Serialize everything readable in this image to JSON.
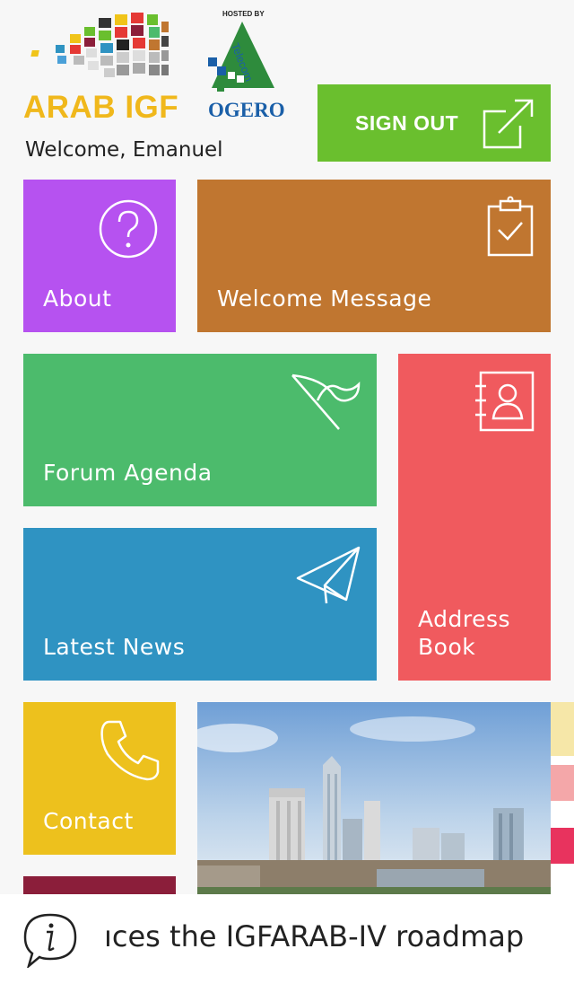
{
  "header": {
    "logo_text": "ARAB IGF",
    "hosted_by": "HOSTED BY",
    "host_logo_text": "OGERO",
    "host_logo_sub": "Telecom",
    "welcome_text": "Welcome, Emanuel",
    "signout_label": "SIGN OUT"
  },
  "tiles": {
    "about": "About",
    "welcome_message": "Welcome Message",
    "forum_agenda": "Forum Agenda",
    "latest_news": "Latest News",
    "address_book_line1": "Address",
    "address_book_line2": "Book",
    "contact": "Contact"
  },
  "ticker": {
    "text": "ıces the IGFARAB-IV roadmap"
  },
  "colors": {
    "about": "#b652f0",
    "welcome_message": "#c07630",
    "forum_agenda": "#4cbb6c",
    "latest_news": "#2f93c2",
    "address_book": "#f05a5e",
    "contact": "#edc11d",
    "signout": "#6abf2e",
    "extra_tile": "#8b1e3a"
  }
}
